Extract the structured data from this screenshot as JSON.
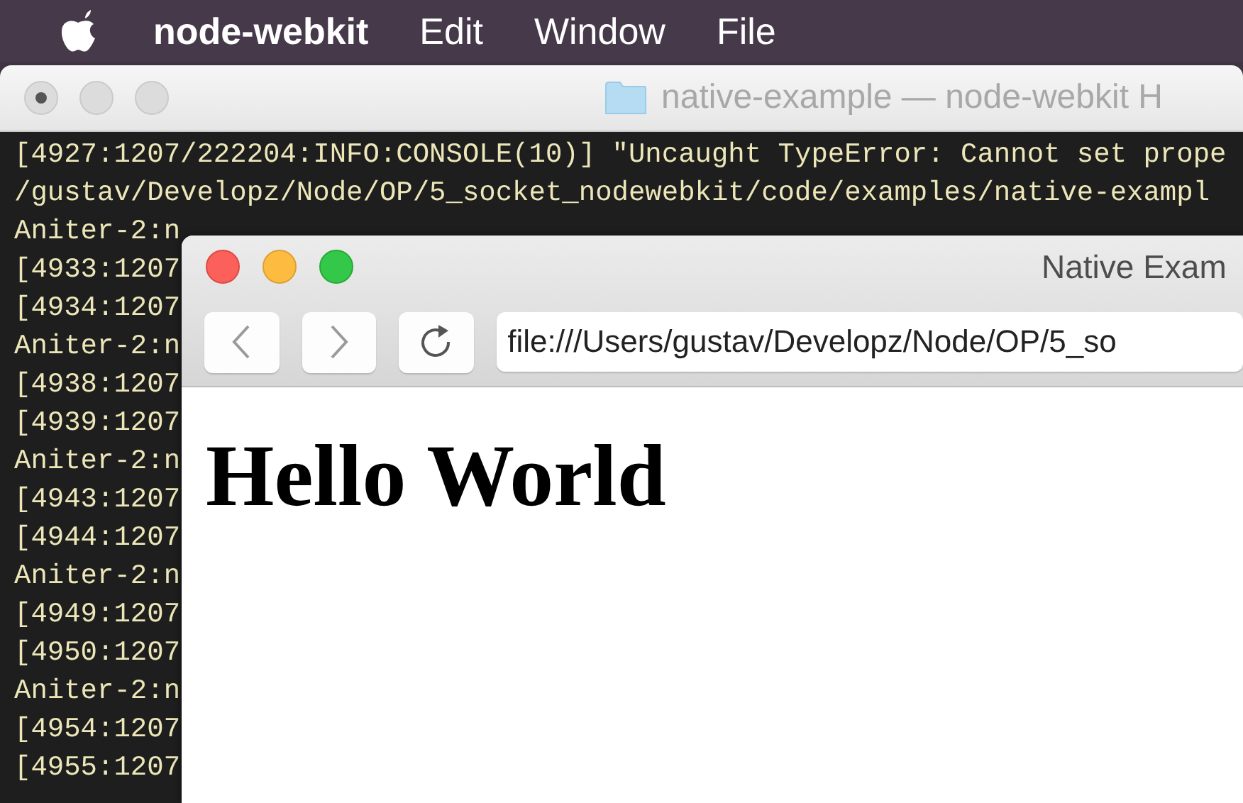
{
  "menu_bar": {
    "items": [
      {
        "label": "node-webkit",
        "kind": "app"
      },
      {
        "label": "Edit",
        "kind": "menu"
      },
      {
        "label": "Window",
        "kind": "menu"
      },
      {
        "label": "File",
        "kind": "menu"
      }
    ]
  },
  "terminal": {
    "title": "native-example — node-webkit H",
    "lines": [
      "[4927:1207/222204:INFO:CONSOLE(10)] \"Uncaught TypeError: Cannot set prope",
      "/gustav/Developz/Node/OP/5_socket_nodewebkit/code/examples/native-exampl",
      "Aniter-2:n",
      "[4933:1207",
      "[4934:1207",
      "Aniter-2:n",
      "[4938:1207",
      "[4939:1207",
      "Aniter-2:n",
      "[4943:1207",
      "[4944:1207",
      "Aniter-2:n",
      "[4949:1207",
      "[4950:1207",
      "Aniter-2:n",
      "[4954:1207",
      "[4955:1207"
    ]
  },
  "browser": {
    "title": "Native Exam",
    "url": "file:///Users/gustav/Developz/Node/OP/5_so",
    "heading": "Hello World"
  }
}
